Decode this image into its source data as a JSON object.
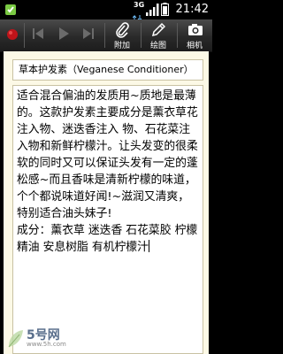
{
  "status_bar": {
    "network": "3G",
    "time": "21:42"
  },
  "toolbar": {
    "attach_label": "附加",
    "draw_label": "绘图",
    "camera_label": "相机"
  },
  "note": {
    "title": "草本护发素（Veganese Conditioner）",
    "body": "适合混合偏油的发质用~质地是最薄的。这款护发素主要成分是薰衣草花注入物、迷迭香注入 物、石花菜注入物和新鲜柠檬汁。让头发变的很柔软的同时又可以保证头发有一定的蓬松感~而且香味是清新柠檬的味道，个个都说味道好闻!~滋润又清爽，特别适合油头妹子!\n成分：薰衣草 迷迭香 石花菜胶 柠檬精油 安息树脂 有机柠檬汁"
  },
  "watermark": {
    "logo": "5号网",
    "url": "www.5h.com"
  },
  "colors": {
    "paper": "#fcf9e6",
    "record_button": "#c0141a",
    "toolbar": "#2a2a2a"
  }
}
